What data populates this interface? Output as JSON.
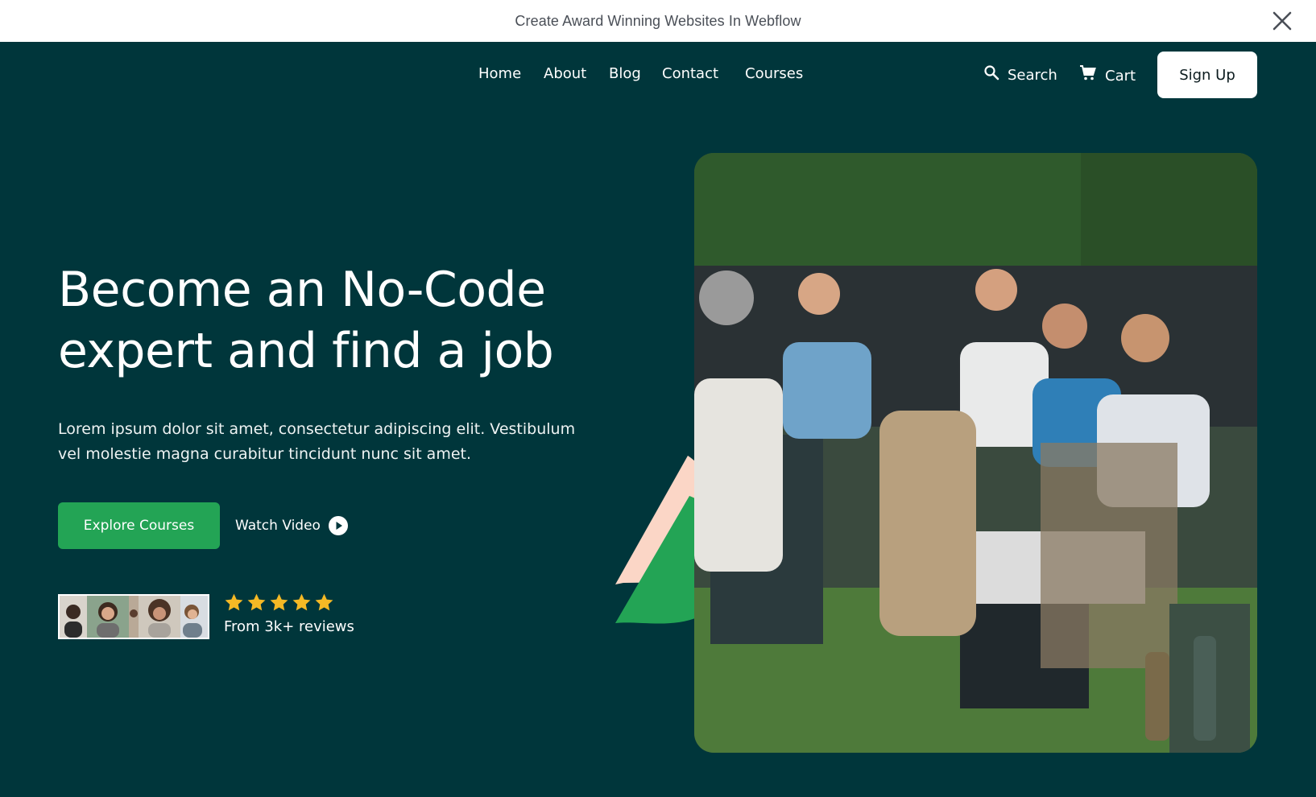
{
  "announcement": {
    "text": "Create Award Winning Websites In Webflow",
    "close_icon": "close-icon"
  },
  "nav": {
    "links": [
      "Home",
      "About",
      "Blog",
      "Contact",
      "Courses"
    ],
    "search_label": "Search",
    "search_icon": "search-icon",
    "cart_label": "Cart",
    "cart_icon": "cart-icon",
    "signup_label": "Sign Up"
  },
  "hero": {
    "title_line1": "Become an No-Code",
    "title_line2": "expert and find a job",
    "subtitle_line1": "Lorem ipsum dolor sit amet, consectetur adipiscing elit. Vestibulum",
    "subtitle_line2": "vel molestie magna curabitur tincidunt nunc sit amet.",
    "primary_button": "Explore Courses",
    "video_button": "Watch Video",
    "play_icon": "play-circle-icon"
  },
  "reviews": {
    "rating": 5,
    "max_rating": 5,
    "text": "From 3k+ reviews",
    "avatar_count": 5
  },
  "colors": {
    "background": "#00363b",
    "accent_green": "#23a455",
    "star": "#f5b925",
    "peach": "#fbd6c6",
    "announcement_bg": "#ffffff"
  }
}
